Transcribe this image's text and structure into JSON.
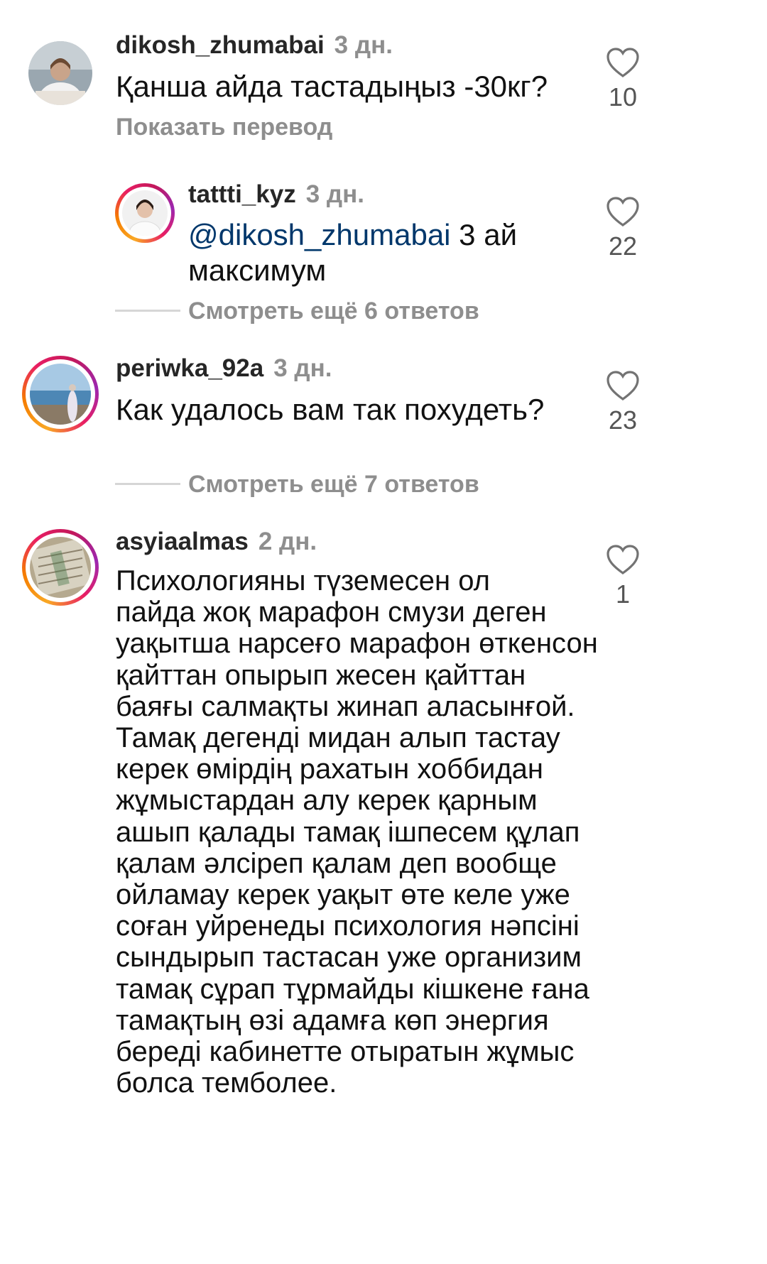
{
  "comments": [
    {
      "username": "dikosh_zhumabai",
      "time": "3 дн.",
      "text": "Қанша айда тастадыңыз -30кг?",
      "likes": "10",
      "translate": "Показать перевод"
    },
    {
      "username": "tattti_kyz",
      "time": "3 дн.",
      "mention": "@dikosh_zhumabai",
      "text_after": " 3 ай",
      "text_line2": "максимум",
      "likes": "22"
    },
    {
      "username": "periwka_92a",
      "time": "3 дн.",
      "text": "Как удалось вам так похудеть?",
      "likes": "23"
    },
    {
      "username": "asyiaalmas",
      "time": "2 дн.",
      "lines": [
        "Психологияны түземесен ол",
        "пайда жоқ марафон смузи деген",
        "уақытша нарсеғо марафон өткенсон",
        "қайттан опырып жесен қайттан",
        "баяғы салмақты жинап аласынғой.",
        "Тамақ дегенді мидан алып тастау",
        "керек өмірдің рахатын хоббидан",
        "жұмыстардан алу керек қарным",
        "ашып қалады тамақ ішпесем құлап",
        "қалам әлсіреп қалам деп вообще",
        "ойламау керек уақыт өте келе уже",
        "соған уйренеды психология нәпсіні",
        "сындырып тастасан уже организим",
        "тамақ сұрап тұрмайды кішкене ғана",
        "тамақтың өзі адамға көп энергия",
        "береді кабинетте отыратын жұмыс",
        "болса темболее."
      ],
      "likes": "1"
    }
  ],
  "replies_links": [
    "Смотреть ещё 6 ответов",
    "Смотреть ещё 7 ответов"
  ],
  "icons": {
    "like": "heart-outline-icon"
  },
  "colors": {
    "mention": "#00376b",
    "secondary": "#8e8e8e",
    "ring": "#e91e63"
  }
}
